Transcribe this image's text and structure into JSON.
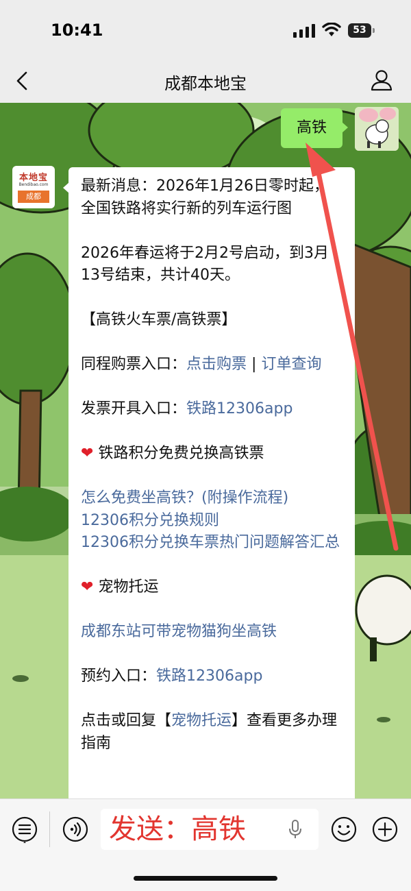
{
  "status_bar": {
    "time": "10:41",
    "battery": "53",
    "icons": [
      "signal-icon",
      "wifi-icon",
      "battery-icon"
    ]
  },
  "nav": {
    "title": "成都本地宝",
    "back_icon": "back-chevron-icon",
    "profile_icon": "profile-icon"
  },
  "chat": {
    "outgoing_message": "高铁",
    "bot_avatar": {
      "logo_text": "本地宝",
      "logo_sub": "Bendibao.com",
      "logo_city": "成都"
    },
    "reply": {
      "news": "最新消息：2026年1月26日零时起，全国铁路将实行新的列车运行图",
      "spring": "2026年春运将于2月2号启动，到3月13号结束，共计40天。",
      "section_tickets": "【高铁火车票/高铁票】",
      "buy_label": "同程购票入口：",
      "buy_link": "点击购票",
      "separator": " | ",
      "order_link": "订单查询",
      "invoice_label": "发票开具入口：",
      "invoice_link": "铁路12306app",
      "points_heading": "铁路积分免费兑换高铁票",
      "points_link1": "怎么免费坐高铁？(附操作流程)",
      "points_link2": "12306积分兑换规则",
      "points_link3": "12306积分兑换车票热门问题解答汇总",
      "pet_heading": "宠物托运",
      "pet_link": "成都东站可带宠物猫狗坐高铁",
      "reserve_label": "预约入口：",
      "reserve_link": "铁路12306app",
      "more_prefix": "点击或回复【",
      "more_link": "宠物托运",
      "more_suffix": "】查看更多办理指南"
    },
    "heart_icon": "heart-icon",
    "annotation_color": "#f0524d"
  },
  "input_bar": {
    "text": "发送：高铁",
    "text_color": "#e2352f",
    "icons": [
      "menu-icon",
      "voice-icon",
      "mic-icon",
      "emoji-icon",
      "plus-icon"
    ]
  }
}
